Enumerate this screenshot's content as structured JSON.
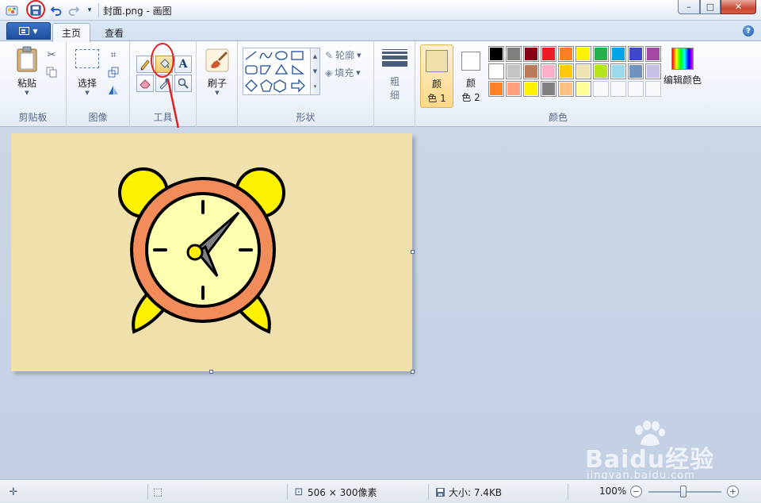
{
  "title_bar": {
    "title": "封面.png - 画图",
    "controls": {
      "minimize": "–",
      "maximize": "□",
      "close": "✕"
    }
  },
  "quick_access": {
    "items": [
      "app-icon",
      "save-icon",
      "undo-icon",
      "redo-icon",
      "customize-icon"
    ]
  },
  "tabs": [
    {
      "label": "主页",
      "active": true
    },
    {
      "label": "查看",
      "active": false
    }
  ],
  "help": {
    "label": "?"
  },
  "ribbon": {
    "clipboard": {
      "label": "剪贴板",
      "paste_label": "粘贴"
    },
    "image": {
      "label": "图像",
      "select_label": "选择"
    },
    "tools": {
      "label": "工具",
      "text_tool_glyph": "A"
    },
    "brushes": {
      "label": "刷子"
    },
    "shapes": {
      "label": "形状",
      "outline_label": "轮廓",
      "fill_label": "填充"
    },
    "size": {
      "label_1": "粗",
      "label_2": "细"
    },
    "colors": {
      "group_label": "颜色",
      "color1_label_1": "颜",
      "color1_label_2": "色 1",
      "color2_label_1": "颜",
      "color2_label_2": "色 2",
      "edit_colors_label": "编辑颜色",
      "color1_value": "#f0e1ac",
      "color2_value": "#ffffff",
      "palette_row1": [
        "#000000",
        "#7f7f7f",
        "#880015",
        "#ed1c24",
        "#ff7f27",
        "#fff200",
        "#22b14c",
        "#00a2e8",
        "#3f48cc",
        "#a349a4"
      ],
      "palette_row2": [
        "#ffffff",
        "#c3c3c3",
        "#b97a57",
        "#ffaec9",
        "#ffc90e",
        "#efe4b0",
        "#b5e61d",
        "#99d9ea",
        "#7092be",
        "#c8bfe7"
      ],
      "palette_row3": [
        "#ff7f27",
        "#ffa07a",
        "#fff200",
        "#7f7f7f",
        "#ffc080",
        "#ffff99"
      ]
    }
  },
  "status_bar": {
    "image_size": "506 × 300像素",
    "file_size": "大小: 7.4KB",
    "zoom": "100%",
    "zoom_out": "−",
    "zoom_in": "+"
  },
  "canvas": {
    "background": "#f0e1ac"
  },
  "watermark": {
    "text": "Baidu经验",
    "url": "jingyan.baidu.com"
  }
}
